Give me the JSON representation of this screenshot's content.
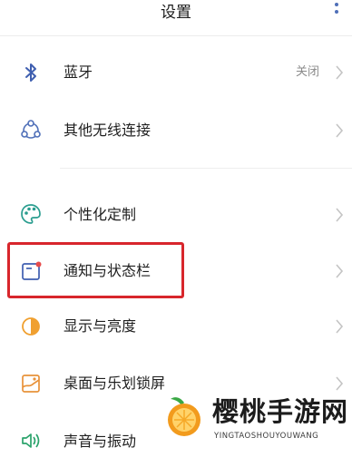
{
  "header": {
    "title": "设置"
  },
  "items": [
    {
      "label": "蓝牙",
      "value": "关闭",
      "icon": "bluetooth-icon"
    },
    {
      "label": "其他无线连接",
      "icon": "wireless-connection-icon"
    },
    {
      "label": "个性化定制",
      "icon": "palette-icon"
    },
    {
      "label": "通知与状态栏",
      "icon": "notification-icon"
    },
    {
      "label": "显示与亮度",
      "icon": "brightness-icon"
    },
    {
      "label": "桌面与乐划锁屏",
      "icon": "wallpaper-icon"
    },
    {
      "label": "声音与振动",
      "icon": "sound-icon"
    }
  ],
  "watermark": {
    "title": "樱桃手游网",
    "subtitle": "YINGTAOSHOUYOUWANG"
  },
  "colors": {
    "accent": "#4f6fb8",
    "highlight": "#d8262c",
    "brightness": "#f0a030",
    "wallpaper": "#e8923a"
  }
}
